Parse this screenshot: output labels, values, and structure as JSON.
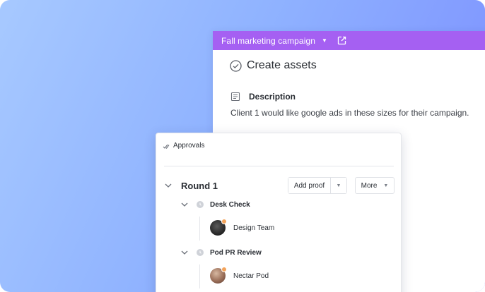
{
  "colors": {
    "header": "#a560f2",
    "bg_from": "#a7c9ff",
    "bg_to": "#7a8cff"
  },
  "task": {
    "list_name": "Fall marketing campaign",
    "title": "Create assets",
    "description_label": "Description",
    "description": "Client 1 would like google ads in these sizes for their campaign."
  },
  "approvals": {
    "title": "Approvals",
    "round": {
      "title": "Round 1",
      "add_proof_label": "Add proof",
      "more_label": "More"
    },
    "steps": [
      {
        "title": "Desk Check",
        "member": "Design Team"
      },
      {
        "title": "Pod PR Review",
        "member": "Nectar Pod"
      }
    ]
  }
}
